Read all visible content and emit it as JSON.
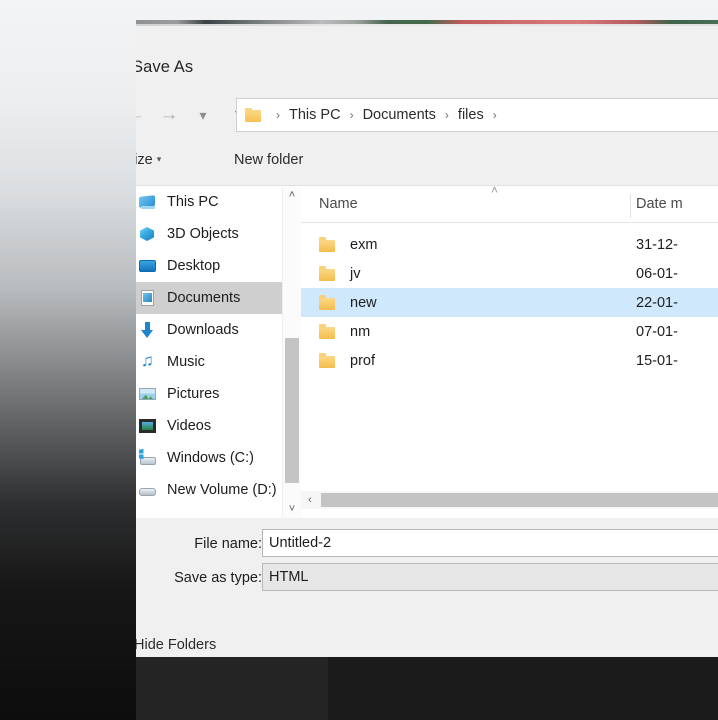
{
  "dialog": {
    "title": "Save As"
  },
  "nav": {
    "back_icon": "arrow-left-icon",
    "forward_icon": "arrow-right-icon",
    "recent_icon": "chevron-down-icon",
    "up_icon": "arrow-up-icon",
    "breadcrumb": {
      "folder_icon": "folder-icon",
      "separator": "›",
      "items": [
        "This PC",
        "Documents",
        "files"
      ],
      "trailing_separator": "›"
    }
  },
  "toolbar": {
    "organize_label": "ganize",
    "organize_full": "Organize",
    "organize_caret": "▾",
    "new_folder_label": "New folder"
  },
  "sidebar": {
    "items": [
      {
        "label": "This PC",
        "icon": "this-pc-icon",
        "selected": false
      },
      {
        "label": "3D Objects",
        "icon": "3d-objects-icon",
        "selected": false
      },
      {
        "label": "Desktop",
        "icon": "desktop-icon",
        "selected": false
      },
      {
        "label": "Documents",
        "icon": "documents-icon",
        "selected": true
      },
      {
        "label": "Downloads",
        "icon": "downloads-icon",
        "selected": false
      },
      {
        "label": "Music",
        "icon": "music-icon",
        "selected": false
      },
      {
        "label": "Pictures",
        "icon": "pictures-icon",
        "selected": false
      },
      {
        "label": "Videos",
        "icon": "videos-icon",
        "selected": false
      },
      {
        "label": "Windows (C:)",
        "icon": "drive-icon",
        "selected": false
      },
      {
        "label": "New Volume (D:)",
        "icon": "drive-icon",
        "selected": false
      }
    ],
    "scrollbar": {
      "up_arrow": "˄",
      "down_arrow": "˅"
    }
  },
  "file_list": {
    "sort_indicator": "˄",
    "columns": [
      {
        "key": "name",
        "label": "Name"
      },
      {
        "key": "date",
        "label": "Date m"
      }
    ],
    "rows": [
      {
        "name": "exm",
        "date": "31-12-",
        "icon": "folder-icon",
        "selected": false
      },
      {
        "name": "jv",
        "date": "06-01-",
        "icon": "folder-icon",
        "selected": false
      },
      {
        "name": "new",
        "date": "22-01-",
        "icon": "folder-icon",
        "selected": true
      },
      {
        "name": "nm",
        "date": "07-01-",
        "icon": "folder-icon",
        "selected": false
      },
      {
        "name": "prof",
        "date": "15-01-",
        "icon": "folder-icon",
        "selected": false
      }
    ],
    "hscrollbar": {
      "left_arrow": "‹"
    }
  },
  "form": {
    "filename_label": "File name:",
    "filename_value": "Untitled-2",
    "savetype_label": "Save as type:",
    "savetype_value": "HTML"
  },
  "footer": {
    "hide_folders_label": "Hide Folders"
  },
  "colors": {
    "selection_blue": "#cfe8fb",
    "sidebar_selection": "#cfcfcf",
    "folder_yellow": "#f3bd4c",
    "dialog_bg": "#f0f0f0"
  }
}
